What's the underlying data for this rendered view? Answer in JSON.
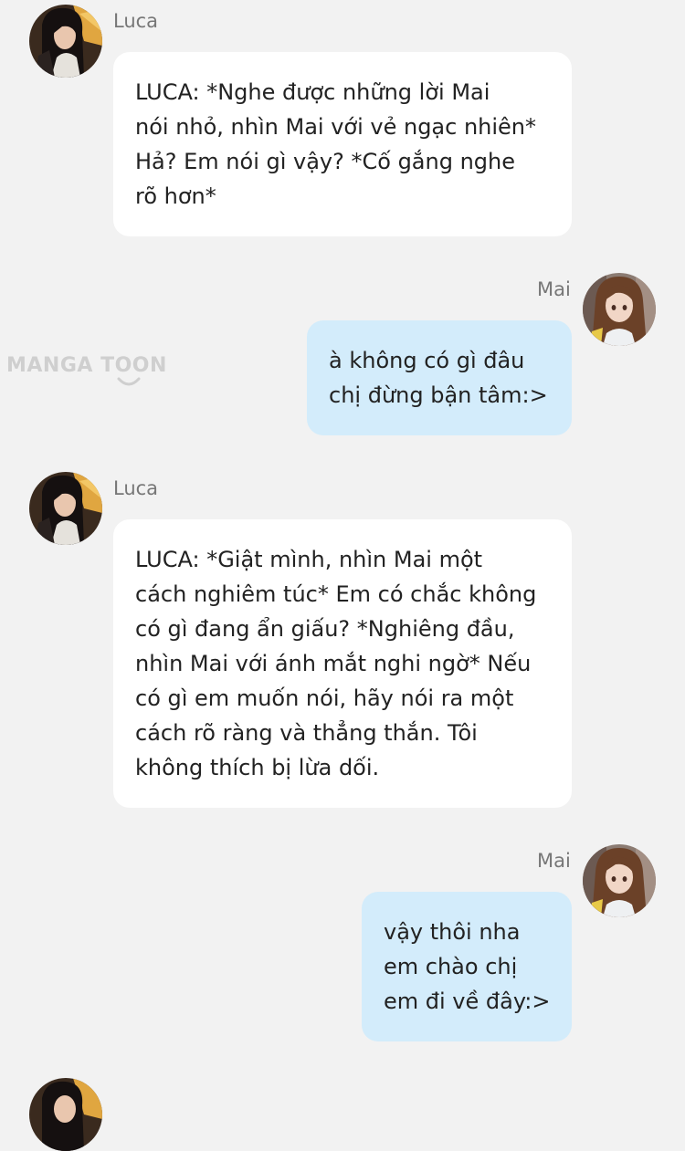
{
  "messages": [
    {
      "sender": "Luca",
      "side": "left",
      "lines": [
        "LUCA: *Nghe được những lời Mai",
        "nói nhỏ, nhìn Mai với vẻ ngạc nhiên*",
        "Hả? Em nói gì vậy? *Cố gắng nghe",
        "rõ hơn*"
      ]
    },
    {
      "sender": "Mai",
      "side": "right",
      "lines": [
        "à không có gì đâu",
        "chị đừng bận tâm:>"
      ]
    },
    {
      "sender": "Luca",
      "side": "left",
      "lines": [
        "LUCA: *Giật mình, nhìn Mai một",
        "cách nghiêm túc* Em có chắc không",
        "có gì đang ẩn giấu? *Nghiêng đầu,",
        "nhìn Mai với ánh mắt nghi ngờ* Nếu",
        "có gì em muốn nói, hãy nói ra một",
        "cách rõ ràng và thẳng thắn. Tôi",
        "không thích bị lừa dối."
      ]
    },
    {
      "sender": "Mai",
      "side": "right",
      "lines": [
        "vậy thôi nha",
        "em chào chị",
        "em đi về đây:>"
      ]
    },
    {
      "sender": "",
      "side": "left",
      "lines": []
    }
  ],
  "watermark": {
    "text": "MANGA TOON"
  }
}
